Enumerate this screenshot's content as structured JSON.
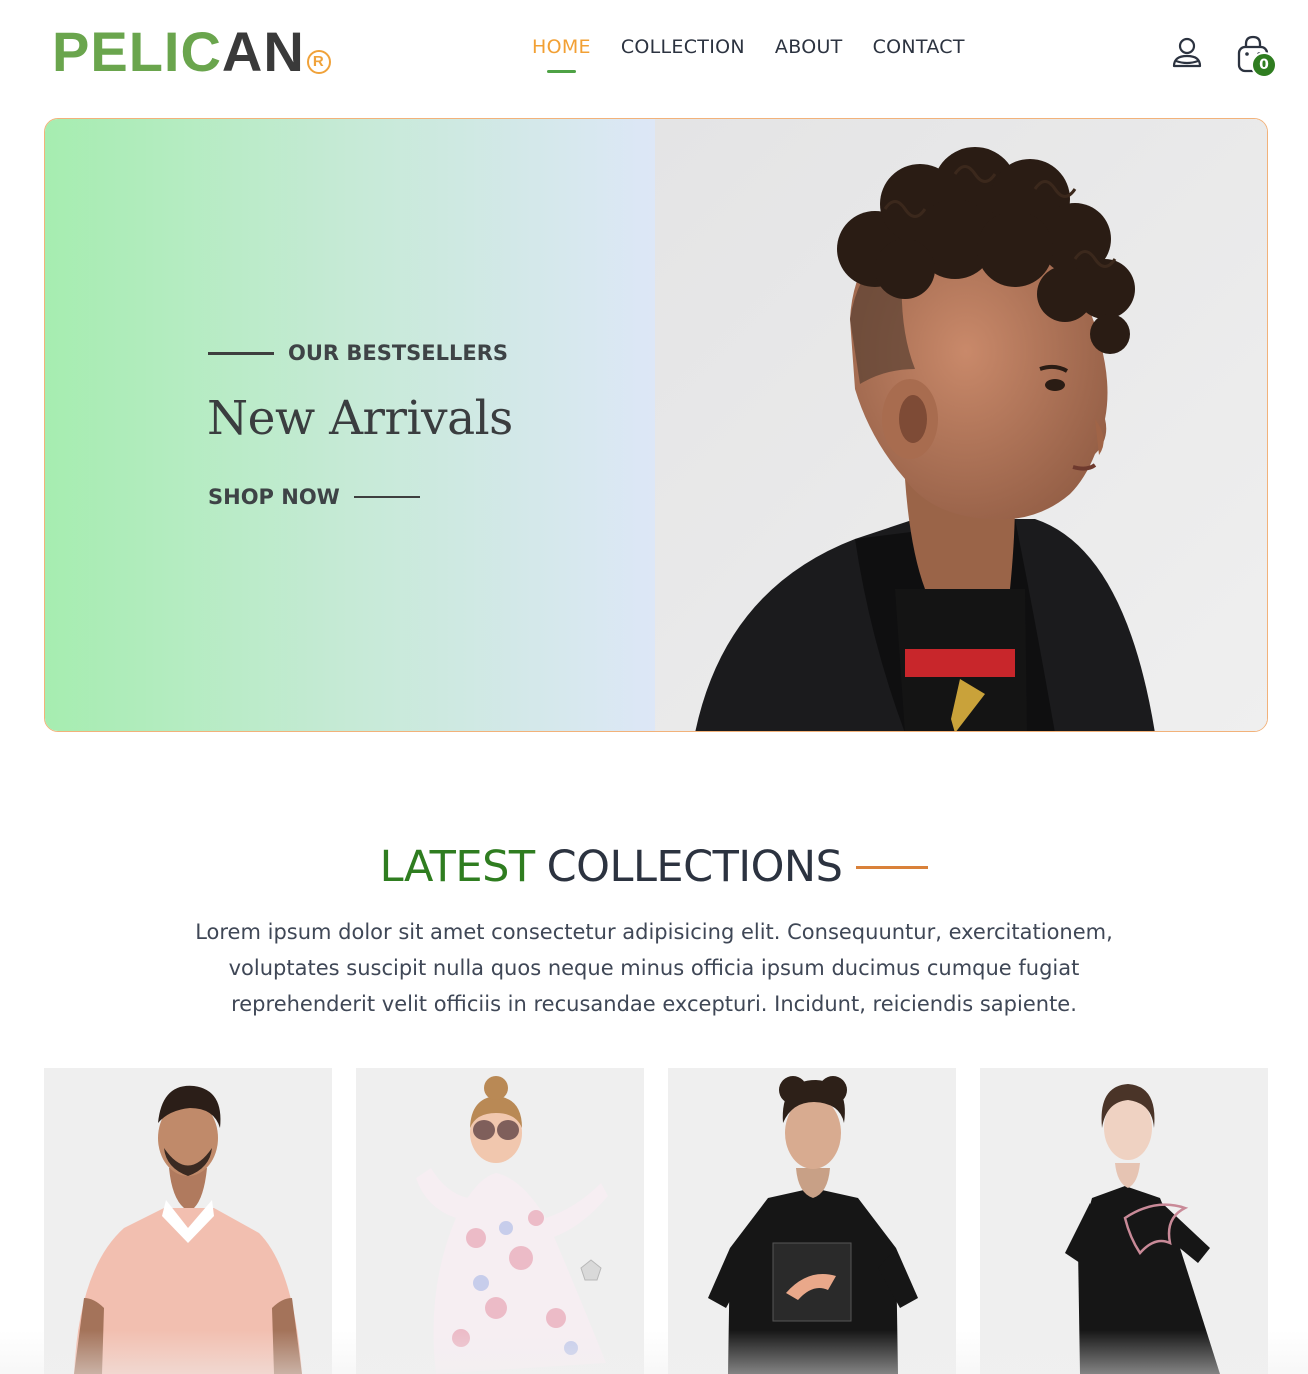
{
  "brand": {
    "logo_green": "PELIC",
    "logo_dark": "AN",
    "logo_mark": "R",
    "colors": {
      "green": "#6aa54d",
      "dark": "#3a3a3a",
      "accent": "#f0a23a"
    }
  },
  "nav": {
    "items": [
      {
        "label": "HOME",
        "active": true
      },
      {
        "label": "COLLECTION",
        "active": false
      },
      {
        "label": "ABOUT",
        "active": false
      },
      {
        "label": "CONTACT",
        "active": false
      }
    ]
  },
  "header_icons": {
    "user": "user-icon",
    "cart": "shopping-bag-icon",
    "cart_count": "0"
  },
  "hero": {
    "eyebrow": "OUR BESTSELLERS",
    "title": "New Arrivals",
    "cta": "SHOP NOW",
    "image": "boy-curly-hair-profile-photo"
  },
  "latest": {
    "title_green": "LATEST",
    "title_dark": "COLLECTIONS",
    "description": "Lorem ipsum dolor sit amet consectetur adipisicing elit. Consequuntur, exercitationem, voluptates suscipit nulla quos neque minus officia ipsum ducimus cumque fugiat reprehenderit velit officiis in recusandae excepturi. Incidunt, reiciendis sapiente."
  },
  "products": [
    {
      "image": "man-pink-polo-shirt"
    },
    {
      "image": "girl-floral-dress-sunglasses"
    },
    {
      "image": "man-black-puma-tshirt"
    },
    {
      "image": "woman-black-puma-tshirt"
    }
  ]
}
